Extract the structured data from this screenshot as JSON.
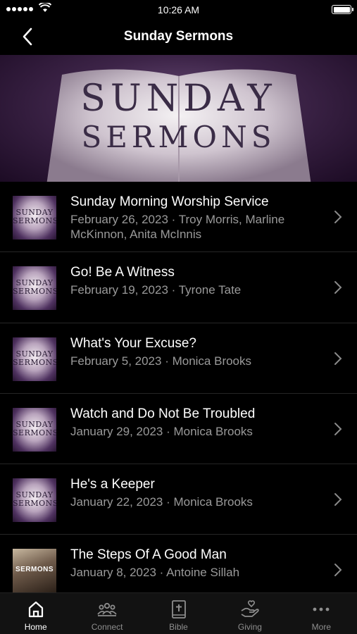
{
  "status_bar": {
    "time": "10:26 AM"
  },
  "nav": {
    "title": "Sunday Sermons"
  },
  "banner": {
    "line1": "SUNDAY",
    "line2": "SERMONS"
  },
  "sermons": [
    {
      "title": "Sunday Morning Worship Service",
      "subtitle": "February 26, 2023 · Troy Morris, Marline McKinnon, Anita McInnis",
      "thumb_line1": "SUNDAY",
      "thumb_line2": "SERMONS"
    },
    {
      "title": "Go! Be A Witness",
      "subtitle": "February 19, 2023 · Tyrone Tate",
      "thumb_line1": "SUNDAY",
      "thumb_line2": "SERMONS"
    },
    {
      "title": "What's Your Excuse?",
      "subtitle": "February 5, 2023 · Monica Brooks",
      "thumb_line1": "SUNDAY",
      "thumb_line2": "SERMONS"
    },
    {
      "title": "Watch and Do Not Be Troubled",
      "subtitle": "January 29, 2023 · Monica Brooks",
      "thumb_line1": "SUNDAY",
      "thumb_line2": "SERMONS"
    },
    {
      "title": "He's a Keeper",
      "subtitle": "January 22, 2023 · Monica Brooks",
      "thumb_line1": "SUNDAY",
      "thumb_line2": "SERMONS"
    },
    {
      "title": "The Steps Of A Good Man",
      "subtitle": "January 8, 2023 · Antoine Sillah",
      "thumb_line1": "SERMONS"
    }
  ],
  "tabs": [
    {
      "label": "Home",
      "icon": "home-icon",
      "active": true
    },
    {
      "label": "Connect",
      "icon": "people-icon",
      "active": false
    },
    {
      "label": "Bible",
      "icon": "bible-icon",
      "active": false
    },
    {
      "label": "Giving",
      "icon": "giving-icon",
      "active": false
    },
    {
      "label": "More",
      "icon": "more-icon",
      "active": false
    }
  ],
  "colors": {
    "background": "#000000",
    "subtitle": "#9a9a9a",
    "tab_inactive": "#8e8e8e",
    "tab_active": "#ffffff"
  }
}
